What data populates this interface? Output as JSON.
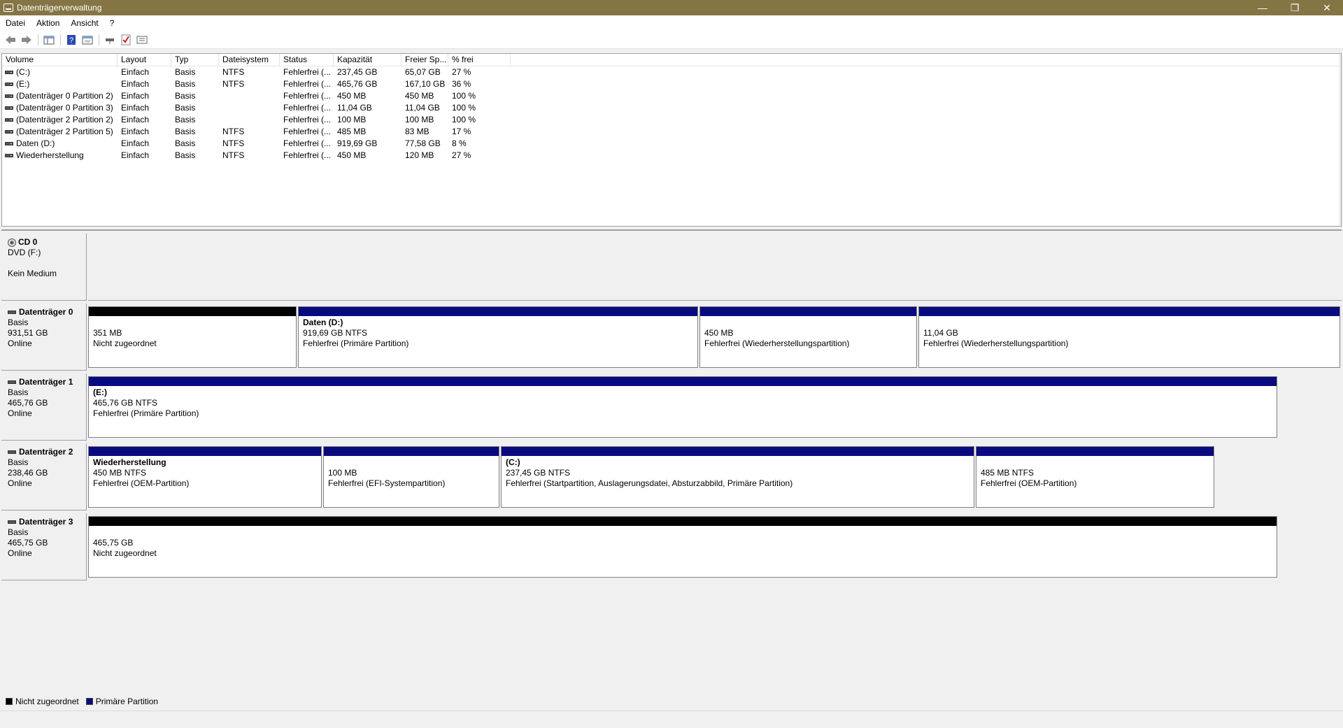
{
  "window": {
    "title": "Datenträgerverwaltung"
  },
  "menu": [
    "Datei",
    "Aktion",
    "Ansicht",
    "?"
  ],
  "volumes": {
    "headers": [
      "Volume",
      "Layout",
      "Typ",
      "Dateisystem",
      "Status",
      "Kapazität",
      "Freier Sp...",
      "% frei"
    ],
    "rows": [
      [
        "(C:)",
        "Einfach",
        "Basis",
        "NTFS",
        "Fehlerfrei (...",
        "237,45 GB",
        "65,07 GB",
        "27 %"
      ],
      [
        "(E:)",
        "Einfach",
        "Basis",
        "NTFS",
        "Fehlerfrei (...",
        "465,76 GB",
        "167,10 GB",
        "36 %"
      ],
      [
        "(Datenträger 0 Partition 2)",
        "Einfach",
        "Basis",
        "",
        "Fehlerfrei (...",
        "450 MB",
        "450 MB",
        "100 %"
      ],
      [
        "(Datenträger 0 Partition 3)",
        "Einfach",
        "Basis",
        "",
        "Fehlerfrei (...",
        "11,04 GB",
        "11,04 GB",
        "100 %"
      ],
      [
        "(Datenträger 2 Partition 2)",
        "Einfach",
        "Basis",
        "",
        "Fehlerfrei (...",
        "100 MB",
        "100 MB",
        "100 %"
      ],
      [
        "(Datenträger 2 Partition 5)",
        "Einfach",
        "Basis",
        "NTFS",
        "Fehlerfrei (...",
        "485 MB",
        "83 MB",
        "17 %"
      ],
      [
        "Daten (D:)",
        "Einfach",
        "Basis",
        "NTFS",
        "Fehlerfrei (...",
        "919,69 GB",
        "77,58 GB",
        "8 %"
      ],
      [
        "Wiederherstellung",
        "Einfach",
        "Basis",
        "NTFS",
        "Fehlerfrei (...",
        "450 MB",
        "120 MB",
        "27 %"
      ]
    ]
  },
  "cd": {
    "name": "CD 0",
    "drive": "DVD (F:)",
    "media": "Kein Medium"
  },
  "disks": [
    {
      "name": "Datenträger 0",
      "type": "Basis",
      "size": "931,51 GB",
      "state": "Online",
      "partitions": [
        {
          "title": "",
          "size": "351 MB",
          "status": "Nicht zugeordnet",
          "kind": "unalloc"
        },
        {
          "title": "Daten  (D:)",
          "size": "919,69 GB NTFS",
          "status": "Fehlerfrei (Primäre Partition)",
          "kind": "primary"
        },
        {
          "title": "",
          "size": "450 MB",
          "status": "Fehlerfrei (Wiederherstellungspartition)",
          "kind": "primary"
        },
        {
          "title": "",
          "size": "11,04 GB",
          "status": "Fehlerfrei (Wiederherstellungspartition)",
          "kind": "primary"
        }
      ]
    },
    {
      "name": "Datenträger 1",
      "type": "Basis",
      "size": "465,76 GB",
      "state": "Online",
      "partitions": [
        {
          "title": "(E:)",
          "size": "465,76 GB NTFS",
          "status": "Fehlerfrei (Primäre Partition)",
          "kind": "primary"
        }
      ]
    },
    {
      "name": "Datenträger 2",
      "type": "Basis",
      "size": "238,46 GB",
      "state": "Online",
      "partitions": [
        {
          "title": "Wiederherstellung",
          "size": "450 MB NTFS",
          "status": "Fehlerfrei (OEM-Partition)",
          "kind": "primary"
        },
        {
          "title": "",
          "size": "100 MB",
          "status": "Fehlerfrei (EFI-Systempartition)",
          "kind": "primary"
        },
        {
          "title": "(C:)",
          "size": "237,45 GB NTFS",
          "status": "Fehlerfrei (Startpartition, Auslagerungsdatei, Absturzabbild, Primäre Partition)",
          "kind": "primary"
        },
        {
          "title": "",
          "size": "485 MB NTFS",
          "status": "Fehlerfrei (OEM-Partition)",
          "kind": "primary"
        }
      ]
    },
    {
      "name": "Datenträger 3",
      "type": "Basis",
      "size": "465,75 GB",
      "state": "Online",
      "partitions": [
        {
          "title": "",
          "size": "465,75 GB",
          "status": "Nicht zugeordnet",
          "kind": "unalloc"
        }
      ]
    }
  ],
  "legend": [
    {
      "label": "Nicht zugeordnet",
      "color": "#000000"
    },
    {
      "label": "Primäre Partition",
      "color": "#0a0a80"
    }
  ],
  "colors": {
    "titlebar": "#857544",
    "primary": "#0a0a80",
    "unallocated": "#000000"
  }
}
